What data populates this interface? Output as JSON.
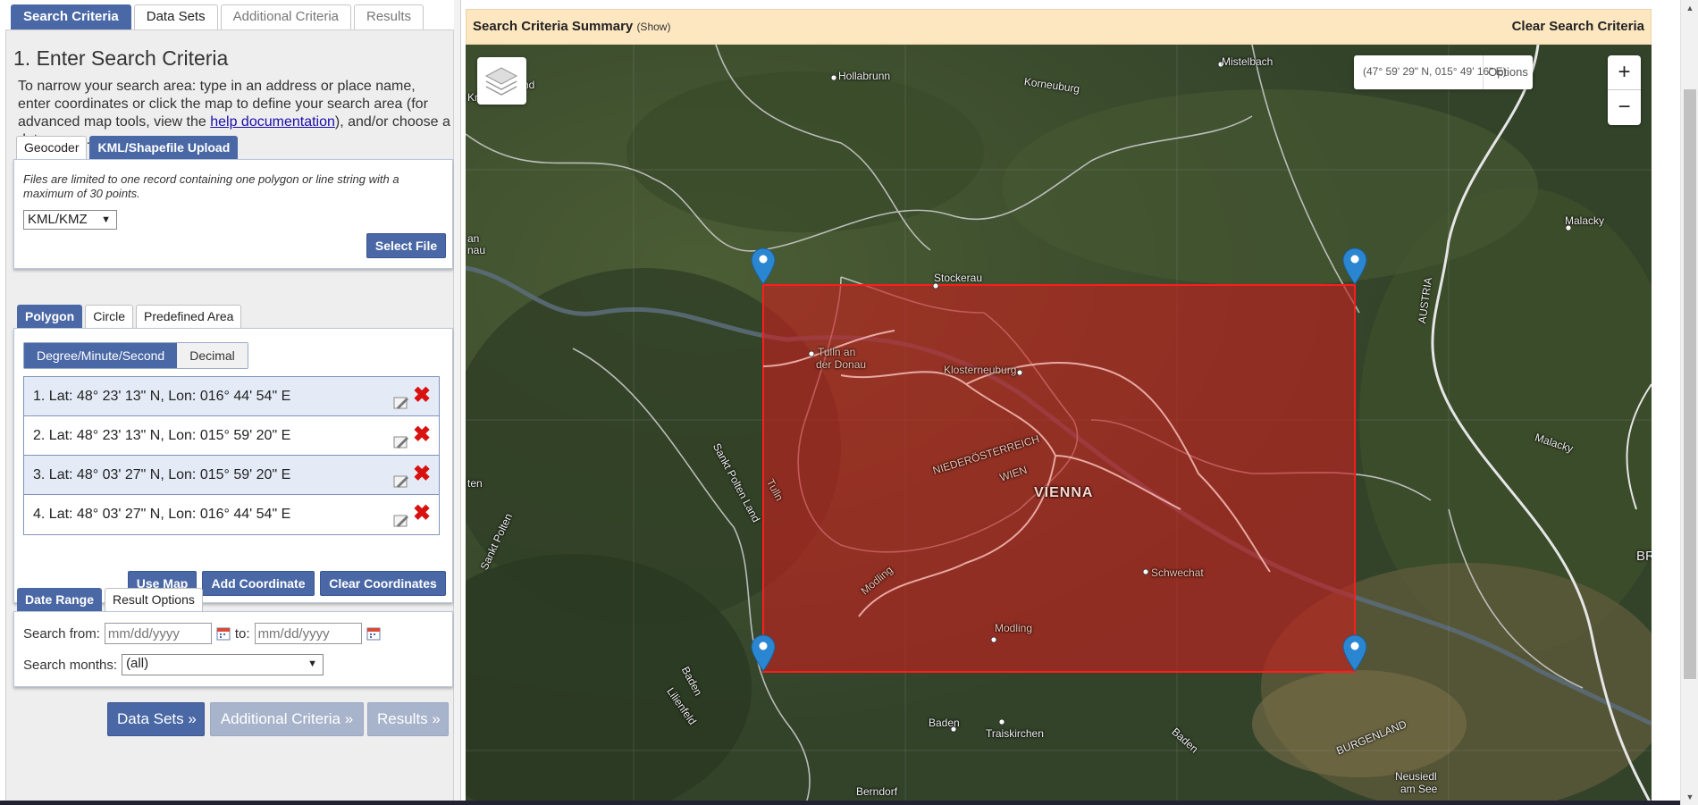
{
  "tabs": [
    {
      "label": "Search Criteria",
      "state": "active"
    },
    {
      "label": "Data Sets",
      "state": "normal"
    },
    {
      "label": "Additional Criteria",
      "state": "muted"
    },
    {
      "label": "Results",
      "state": "muted"
    }
  ],
  "search": {
    "heading": "1. Enter Search Criteria",
    "intro_part1": "To narrow your search area: type in an address or place name, enter coordinates or click the map to define your search area (for advanced map tools, view the ",
    "intro_link": "help documentation",
    "intro_part2": "), and/or choose a date range."
  },
  "upload": {
    "tabs": [
      "Geocoder",
      "KML/Shapefile Upload"
    ],
    "active_tab": "KML/Shapefile Upload",
    "note": "Files are limited to one record containing one polygon or line string with a maximum of 30 points.",
    "format_value": "KML/KMZ",
    "select_file_label": "Select File"
  },
  "area": {
    "tabs": [
      "Polygon",
      "Circle",
      "Predefined Area"
    ],
    "active_tab": "Polygon",
    "format_options": [
      "Degree/Minute/Second",
      "Decimal"
    ],
    "active_format": "Degree/Minute/Second",
    "coordinates": [
      "1.  Lat: 48° 23' 13\" N, Lon: 016° 44' 54\" E",
      "2.  Lat: 48° 23' 13\" N, Lon: 015° 59' 20\" E",
      "3.  Lat: 48° 03' 27\" N, Lon: 015° 59' 20\" E",
      "4.  Lat: 48° 03' 27\" N, Lon: 016° 44' 54\" E"
    ],
    "use_map_label": "Use Map",
    "add_coordinate_label": "Add Coordinate",
    "clear_coordinates_label": "Clear Coordinates"
  },
  "dates": {
    "tabs": [
      "Date Range",
      "Result Options"
    ],
    "active_tab": "Date Range",
    "from_label": "Search from:",
    "from_placeholder": "mm/dd/yyyy",
    "to_label": "to:",
    "to_placeholder": "mm/dd/yyyy",
    "months_label": "Search months:",
    "months_value": "(all)"
  },
  "footer_nav": {
    "data_sets": "Data Sets »",
    "additional": "Additional Criteria »",
    "results": "Results »"
  },
  "summary": {
    "title": "Search Criteria Summary",
    "show": "(Show)",
    "clear": "Clear Search Criteria"
  },
  "map": {
    "coord_readout": "(47° 59' 29\" N, 015° 49' 16\" E)",
    "options_label": "Options",
    "zoom_in": "+",
    "zoom_out": "−",
    "polygon_color": "#d02020",
    "labels": {
      "hollabrunn": "Hollabrunn",
      "mistelbach": "Mistelbach",
      "korneuburg": "Korneuburg",
      "stockerau": "Stockerau",
      "malacky_top": "Malacky",
      "malacky_mid": "Malacky",
      "austria": "AUSTRIA",
      "tulln_1": "Tulln an",
      "tulln_2": "der Donau",
      "klosterneuburg": "Klosterneuburg",
      "niederoesterreich": "NIEDERÖSTERREICH",
      "wien": "WIEN",
      "vienna": "VIENNA",
      "schwechat": "Schwechat",
      "modling": "Modling",
      "modling_district": "Modling",
      "tulln_district": "Tulln",
      "st_polten_land": "Sankt Polten Land",
      "st_polten": "Sankt Polten",
      "baden_district": "Baden",
      "lilienfeld": "Lilienfeld",
      "baden": "Baden",
      "traiskirchen": "Traiskirchen",
      "baden_right": "Baden",
      "burgenland": "BURGENLAND",
      "neusiedl_1": "Neusiedl",
      "neusiedl_2": "am See",
      "berndorf": "Berndorf",
      "br": "BR",
      "ten": "ten",
      "an_1": "an",
      "an_2": "nau",
      "krems_edge": "Kr",
      "land_edge": "nd"
    }
  }
}
